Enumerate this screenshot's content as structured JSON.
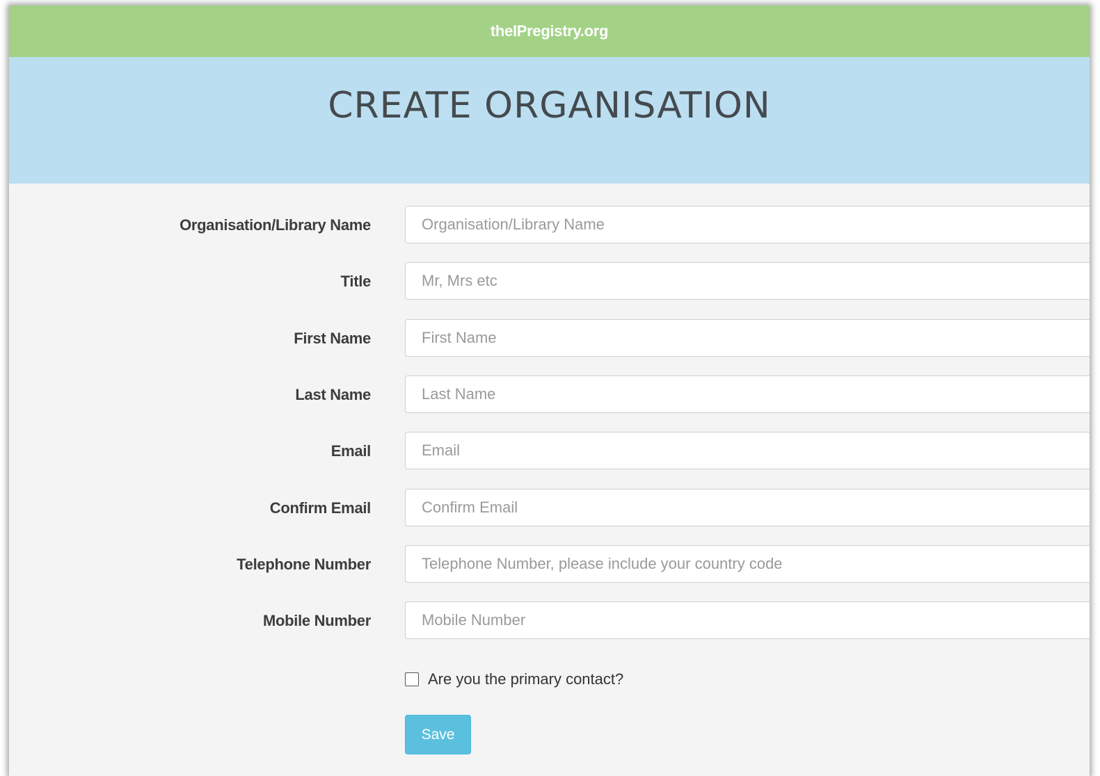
{
  "site": {
    "brand": "theIPregistry.org",
    "colors": {
      "topbar": "#a3d287",
      "hero": "#bbdff1",
      "button": "#5bc0de"
    }
  },
  "page": {
    "title": "CREATE ORGANISATION"
  },
  "form": {
    "fields": [
      {
        "label": "Organisation/Library Name",
        "placeholder": "Organisation/Library Name",
        "value": ""
      },
      {
        "label": "Title",
        "placeholder": "Mr, Mrs etc",
        "value": ""
      },
      {
        "label": "First Name",
        "placeholder": "First Name",
        "value": ""
      },
      {
        "label": "Last Name",
        "placeholder": "Last Name",
        "value": ""
      },
      {
        "label": "Email",
        "placeholder": "Email",
        "value": ""
      },
      {
        "label": "Confirm Email",
        "placeholder": "Confirm Email",
        "value": ""
      },
      {
        "label": "Telephone Number",
        "placeholder": "Telephone Number, please include your country code",
        "value": ""
      },
      {
        "label": "Mobile Number",
        "placeholder": "Mobile Number",
        "value": ""
      }
    ],
    "primary_contact": {
      "label": "Are you the primary contact?",
      "checked": false
    },
    "save_label": "Save"
  }
}
